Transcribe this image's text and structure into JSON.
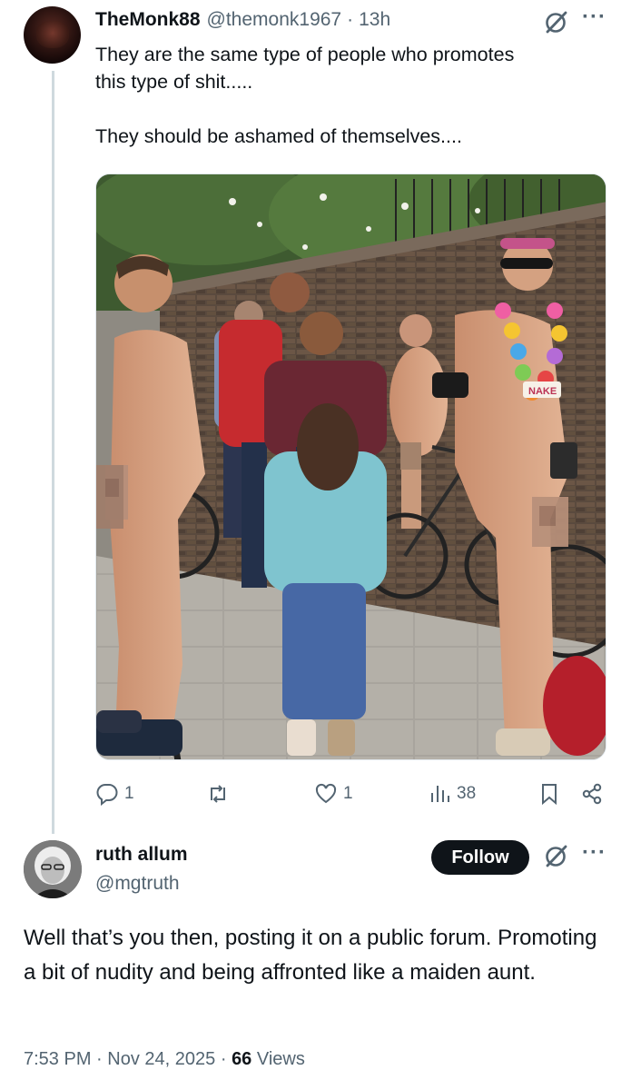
{
  "tweet": {
    "display_name": "TheMonk88",
    "handle": "@themonk1967",
    "separator": "·",
    "time": "13h",
    "text": "They are the same type of people who promotes\nthis type of shit.....\n\nThey should be ashamed of themselves....",
    "more_icon": "more-horizontal-icon",
    "grok_icon": "grok-icon",
    "photo_sign_text": "NAKE",
    "actions": {
      "replies": "1",
      "reposts": "",
      "likes": "1",
      "views": "38"
    }
  },
  "reply": {
    "display_name": "ruth allum",
    "handle": "@mgtruth",
    "follow_label": "Follow",
    "text": "Well that’s you then, posting it on a public forum. Promoting a bit of nudity and being affronted like a maiden aunt.",
    "time": "7:53 PM",
    "separator": "·",
    "date": "Nov 24, 2025",
    "views_count": "66",
    "views_label": "Views"
  },
  "colors": {
    "text": "#0f1419",
    "muted": "#536471",
    "thread_line": "#cfd9de",
    "follow_bg": "#0f1419"
  }
}
